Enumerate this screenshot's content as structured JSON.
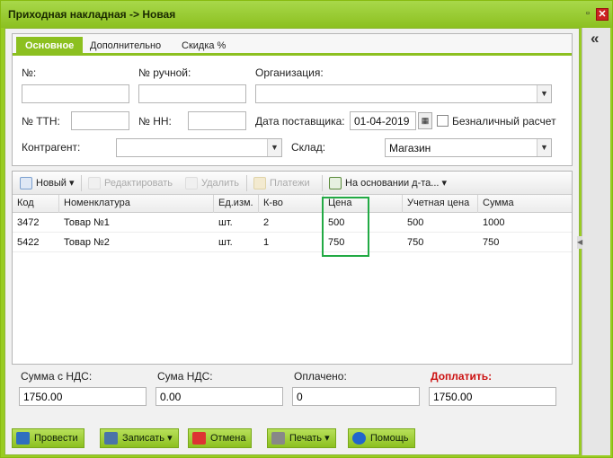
{
  "window": {
    "title": "Приходная накладная -> Новая",
    "minimize_glyph": "▫",
    "close_glyph": "✕",
    "collapse_glyph": "«"
  },
  "tabs": [
    {
      "label": "Основное",
      "active": true
    },
    {
      "label": "Дополнительно",
      "active": false
    },
    {
      "label": "Скидка %",
      "active": false
    }
  ],
  "form": {
    "number_label": "№:",
    "number_value": "",
    "manual_number_label": "№ ручной:",
    "manual_number_value": "",
    "organization_label": "Организация:",
    "organization_value": "",
    "ttn_label": "№ ТТН:",
    "ttn_value": "",
    "nn_label": "№ НН:",
    "nn_value": "",
    "supplier_date_label": "Дата поставщика:",
    "supplier_date_value": "01-04-2019",
    "noncash_label": "Безналичный расчет",
    "noncash_checked": false,
    "counterparty_label": "Контрагент:",
    "counterparty_value": "",
    "warehouse_label": "Склад:",
    "warehouse_value": "Магазин"
  },
  "toolbar": {
    "new_label": "Новый",
    "edit_label": "Редактировать",
    "delete_label": "Удалить",
    "payments_label": "Платежи",
    "based_on_label": "На основании д-та..."
  },
  "table": {
    "columns": [
      "Код",
      "Номенклатура",
      "Ед.изм.",
      "К-во",
      "Цена",
      "Учетная цена",
      "Сумма"
    ],
    "rows": [
      [
        "3472",
        "Товар №1",
        "шт.",
        "2",
        "500",
        "500",
        "1000"
      ],
      [
        "5422",
        "Товар №2",
        "шт.",
        "1",
        "750",
        "750",
        "750"
      ]
    ]
  },
  "totals": {
    "sum_with_vat_label": "Сумма с НДС:",
    "sum_with_vat_value": "1750.00",
    "vat_sum_label": "Сума НДС:",
    "vat_sum_value": "0.00",
    "paid_label": "Оплачено:",
    "paid_value": "0",
    "to_pay_label": "Доплатить:",
    "to_pay_value": "1750.00"
  },
  "buttons": {
    "post_label": "Провести",
    "save_label": "Записать",
    "cancel_label": "Отмена",
    "print_label": "Печать",
    "help_label": "Помощь"
  },
  "colors": {
    "accent": "#8cc020",
    "highlight_box": "#22aa44",
    "to_pay_label": "#cc1111"
  }
}
